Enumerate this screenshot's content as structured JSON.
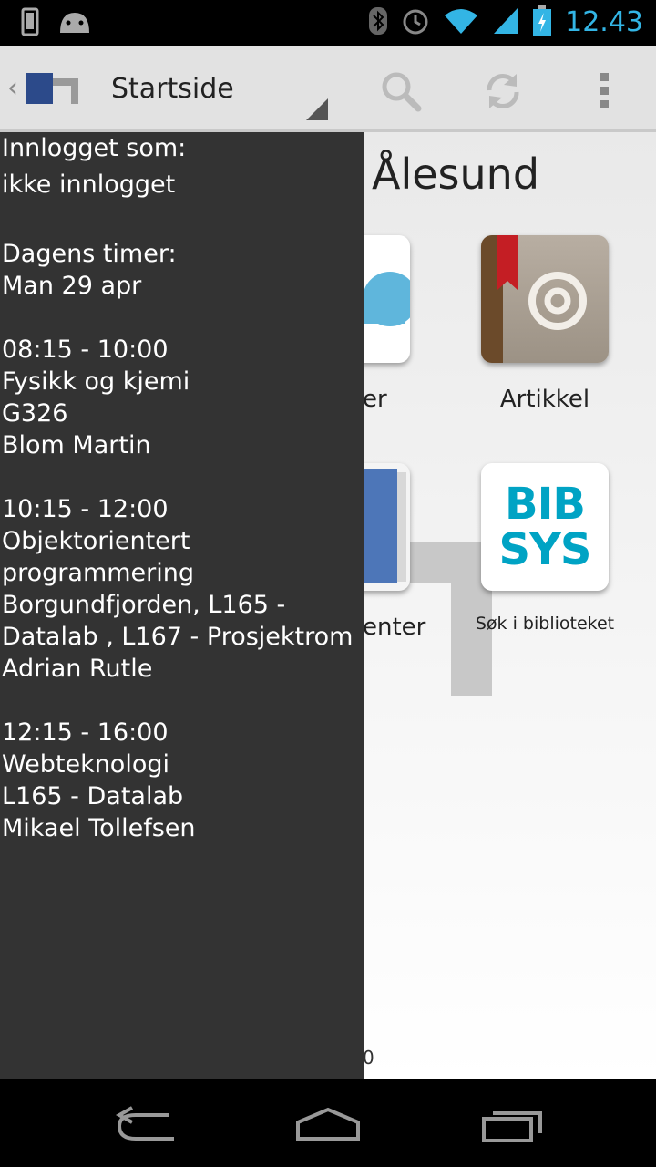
{
  "status_bar": {
    "time": "12.43",
    "icons": [
      "phone-icon",
      "android-icon",
      "bluetooth-icon",
      "alarm-icon",
      "wifi-icon",
      "signal-icon",
      "battery-icon"
    ]
  },
  "action_bar": {
    "title": "Startside",
    "icons": [
      "app-logo-icon",
      "search-icon",
      "refresh-icon",
      "overflow-menu-icon"
    ]
  },
  "main": {
    "city": "Ålesund",
    "tiles": [
      {
        "label": "er",
        "icon": "cloud-icon"
      },
      {
        "label": "Artikkel",
        "icon": "address-book-icon"
      },
      {
        "label": "enter",
        "icon": "book-icon"
      },
      {
        "label": "Søk i biblioteket",
        "icon": "bibsys-logo",
        "logo_text": [
          "BIB",
          "SYS"
        ]
      }
    ],
    "footer_num": "0"
  },
  "drawer": {
    "login_label": "Innlogget som:",
    "login_value": "ikke innlogget",
    "today_label": "Dagens timer:",
    "date": "Man 29 apr",
    "lessons": [
      {
        "time": "08:15 - 10:00",
        "lines": [
          "Fysikk og kjemi",
          "G326",
          "Blom Martin"
        ]
      },
      {
        "time": "10:15 - 12:00",
        "lines": [
          "Objektorientert",
          "programmering",
          "Borgundfjorden, L165 -",
          "Datalab , L167 - Prosjektrom",
          "Adrian Rutle"
        ]
      },
      {
        "time": "12:15 - 16:00",
        "lines": [
          "Webteknologi",
          "L165 - Datalab",
          "Mikael Tollefsen"
        ]
      }
    ]
  },
  "colors": {
    "accent": "#33b5e5",
    "drawer_bg": "#333333",
    "bibsys_blue": "#00a3c4"
  }
}
